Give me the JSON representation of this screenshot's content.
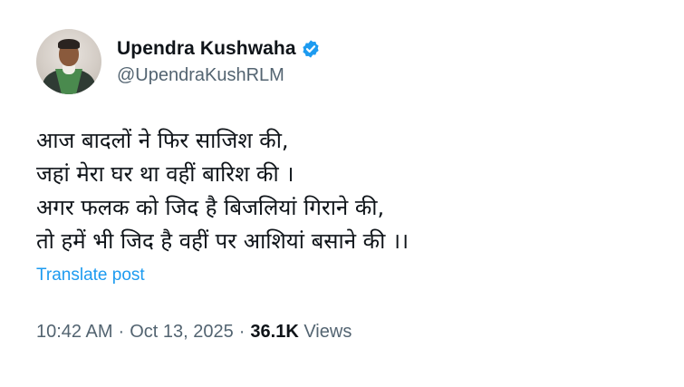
{
  "author": {
    "display_name": "Upendra Kushwaha",
    "handle": "@UpendraKushRLM",
    "verified": true,
    "verified_color": "#1d9bf0"
  },
  "post": {
    "lines": [
      "आज बादलों ने फिर साजिश की,",
      "जहां मेरा घर था वहीं बारिश की ।",
      "अगर फलक को जिद है बिजलियां गिराने की,",
      "तो हमें भी जिद है वहीं पर आशियां बसाने की ।।"
    ],
    "translate_label": "Translate post"
  },
  "meta": {
    "time": "10:42 AM",
    "separator": "·",
    "date": "Oct 13, 2025",
    "views_count": "36.1K",
    "views_label": "Views"
  },
  "icons": {
    "verified": "verified-badge-icon"
  },
  "colors": {
    "text": "#0f1419",
    "secondary": "#536471",
    "link": "#1d9bf0"
  }
}
